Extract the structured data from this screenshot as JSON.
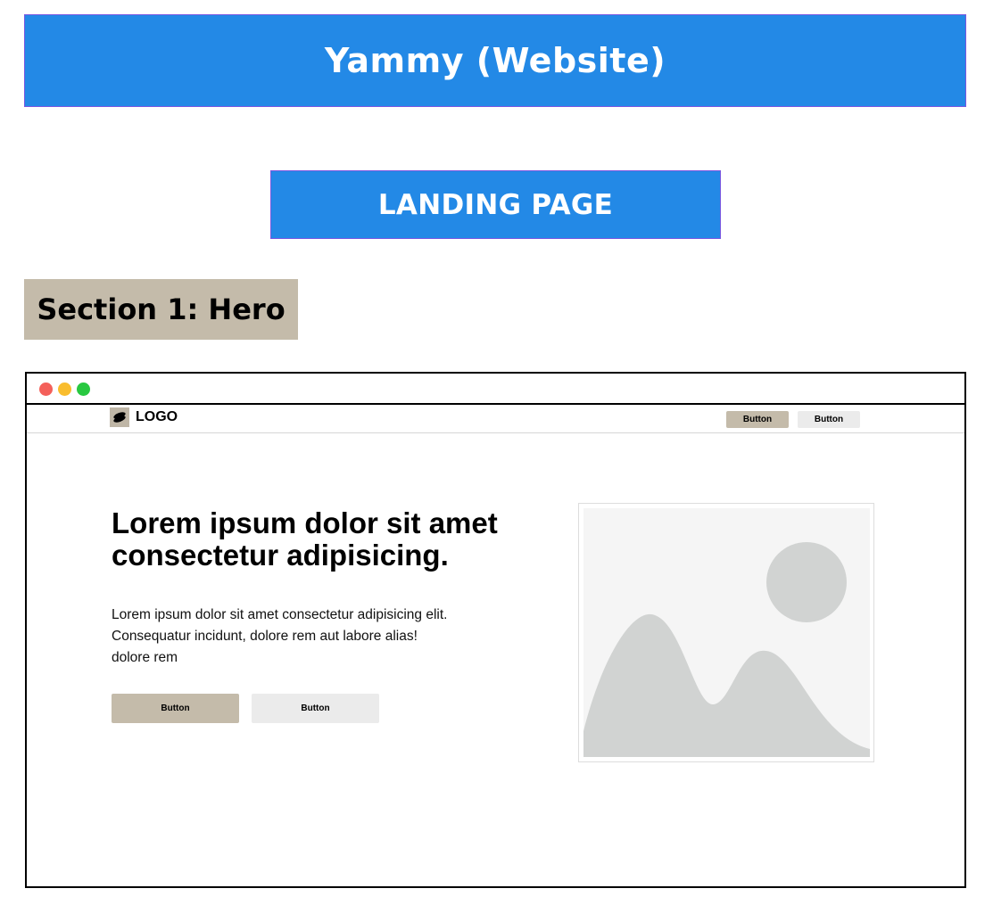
{
  "header": {
    "title": "Yammy (Website)"
  },
  "page": {
    "name": "LANDING PAGE"
  },
  "section": {
    "title": "Section 1: Hero"
  },
  "browser": {
    "window_controls": [
      "close",
      "minimize",
      "maximize"
    ],
    "colors": {
      "close": "#f4605a",
      "minimize": "#f9bd2e",
      "maximize": "#28c840"
    }
  },
  "nav": {
    "logo_text": "LOGO",
    "primary_button": "Button",
    "secondary_button": "Button"
  },
  "hero": {
    "heading": "Lorem ipsum dolor sit amet consectetur adipisicing.",
    "body": "Lorem ipsum dolor sit amet consectetur adipisicing elit.\nConsequatur incidunt, dolore rem aut labore alias!\n dolore rem",
    "primary_button": "Button",
    "secondary_button": "Button",
    "image_icon": "image-placeholder-icon"
  },
  "colors": {
    "banner": "#2389e6",
    "section_tag": "#c4bbaa",
    "primary_button": "#c4bbaa",
    "secondary_button": "#ebebeb"
  }
}
